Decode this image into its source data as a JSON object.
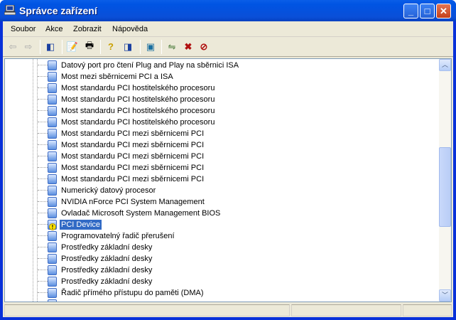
{
  "window": {
    "title": "Správce zařízení",
    "icon": "computer-icon"
  },
  "menu": [
    "Soubor",
    "Akce",
    "Zobrazit",
    "Nápověda"
  ],
  "toolbar": [
    "back-icon",
    "forward-icon",
    "show-hide-tree-icon",
    "properties-icon",
    "print-icon",
    "help-icon",
    "action-pane-icon",
    "scan-hardware-icon",
    "update-driver-icon",
    "uninstall-icon",
    "disable-icon"
  ],
  "tree": [
    {
      "label": "Datový port pro čtení Plug and Play na sběrnici ISA"
    },
    {
      "label": "Most mezi sběrnicemi PCI a ISA"
    },
    {
      "label": "Most standardu PCI hostitelského procesoru"
    },
    {
      "label": "Most standardu PCI hostitelského procesoru"
    },
    {
      "label": "Most standardu PCI hostitelského procesoru"
    },
    {
      "label": "Most standardu PCI hostitelského procesoru"
    },
    {
      "label": "Most standardu PCI mezi sběrnicemi PCI"
    },
    {
      "label": "Most standardu PCI mezi sběrnicemi PCI"
    },
    {
      "label": "Most standardu PCI mezi sběrnicemi PCI"
    },
    {
      "label": "Most standardu PCI mezi sběrnicemi PCI"
    },
    {
      "label": "Most standardu PCI mezi sběrnicemi PCI"
    },
    {
      "label": "Numerický datový procesor"
    },
    {
      "label": "NVIDIA nForce PCI System Management"
    },
    {
      "label": "Ovladač Microsoft System Management BIOS"
    },
    {
      "label": "PCI Device",
      "warning": true,
      "selected": true
    },
    {
      "label": "Programovatelný řadič přerušení"
    },
    {
      "label": "Prostředky základní desky"
    },
    {
      "label": "Prostředky základní desky"
    },
    {
      "label": "Prostředky základní desky"
    },
    {
      "label": "Prostředky základní desky"
    },
    {
      "label": "Řadič přímého přístupu do paměti (DMA)"
    },
    {
      "label": ""
    }
  ],
  "scroll": {
    "position_fraction": 0.55
  }
}
